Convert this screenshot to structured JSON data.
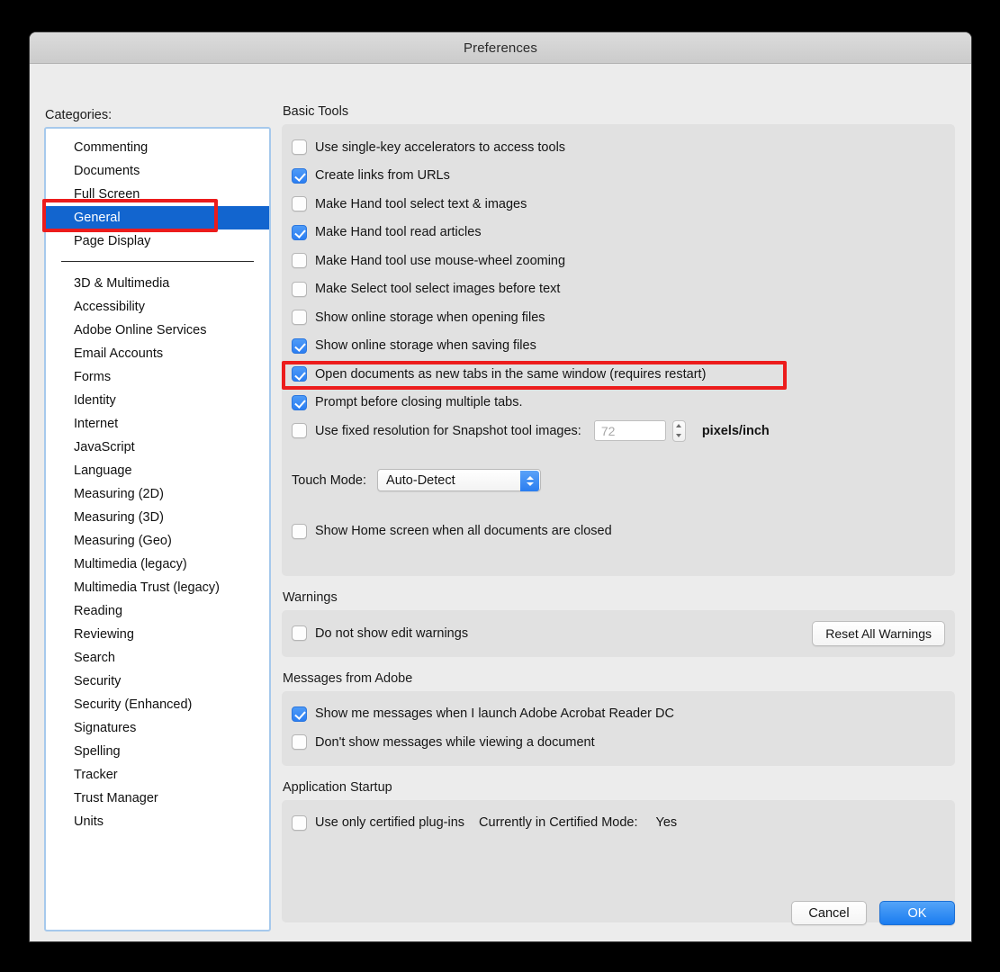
{
  "window": {
    "title": "Preferences"
  },
  "sidebar": {
    "label": "Categories:",
    "top_items": [
      "Commenting",
      "Documents",
      "Full Screen",
      "General",
      "Page Display"
    ],
    "selected": "General",
    "bottom_items": [
      "3D & Multimedia",
      "Accessibility",
      "Adobe Online Services",
      "Email Accounts",
      "Forms",
      "Identity",
      "Internet",
      "JavaScript",
      "Language",
      "Measuring (2D)",
      "Measuring (3D)",
      "Measuring (Geo)",
      "Multimedia (legacy)",
      "Multimedia Trust (legacy)",
      "Reading",
      "Reviewing",
      "Search",
      "Security",
      "Security (Enhanced)",
      "Signatures",
      "Spelling",
      "Tracker",
      "Trust Manager",
      "Units"
    ]
  },
  "basic_tools": {
    "label": "Basic Tools",
    "checkboxes": [
      {
        "label": "Use single-key accelerators to access tools",
        "checked": false
      },
      {
        "label": "Create links from URLs",
        "checked": true
      },
      {
        "label": "Make Hand tool select text & images",
        "checked": false
      },
      {
        "label": "Make Hand tool read articles",
        "checked": true
      },
      {
        "label": "Make Hand tool use mouse-wheel zooming",
        "checked": false
      },
      {
        "label": "Make Select tool select images before text",
        "checked": false
      },
      {
        "label": "Show online storage when opening files",
        "checked": false
      },
      {
        "label": "Show online storage when saving files",
        "checked": true
      },
      {
        "label": "Open documents as new tabs in the same window (requires restart)",
        "checked": true
      },
      {
        "label": "Prompt before closing multiple tabs.",
        "checked": true
      }
    ],
    "resolution": {
      "label": "Use fixed resolution for Snapshot tool images:",
      "checked": false,
      "value": "72",
      "unit": "pixels/inch"
    },
    "touch_mode": {
      "label": "Touch Mode:",
      "value": "Auto-Detect"
    },
    "home_screen": {
      "label": "Show Home screen when all documents are closed",
      "checked": false
    }
  },
  "warnings": {
    "label": "Warnings",
    "checkbox": {
      "label": "Do not show edit warnings",
      "checked": false
    },
    "reset_button": "Reset All Warnings"
  },
  "messages": {
    "label": "Messages from Adobe",
    "checkboxes": [
      {
        "label": "Show me messages when I launch Adobe Acrobat Reader DC",
        "checked": true
      },
      {
        "label": "Don't show messages while viewing a document",
        "checked": false
      }
    ]
  },
  "startup": {
    "label": "Application Startup",
    "checkbox": {
      "label": "Use only certified plug-ins",
      "checked": false
    },
    "mode_label": "Currently in Certified Mode:",
    "mode_value": "Yes"
  },
  "footer": {
    "cancel": "Cancel",
    "ok": "OK"
  },
  "colors": {
    "accent_blue": "#2b7ef2",
    "selection_blue": "#1265cf",
    "highlight_red": "#ec1c1c",
    "panel_gray": "#e1e1e1",
    "window_gray": "#ececec"
  }
}
